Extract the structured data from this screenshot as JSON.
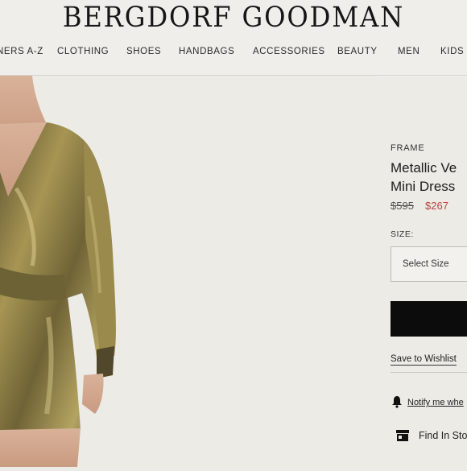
{
  "header": {
    "logo": "BERGDORF GOODMAN",
    "nav": [
      "NERS A-Z",
      "CLOTHING",
      "SHOES",
      "HANDBAGS",
      "ACCESSORIES",
      "BEAUTY",
      "MEN",
      "KIDS"
    ]
  },
  "product": {
    "brand": "FRAME",
    "title_line1": "Metallic Ve",
    "title_line2": "Mini Dress",
    "price_original": "$595",
    "price_sale": "$267",
    "size_label": "SIZE:",
    "size_placeholder": "Select Size",
    "save_wishlist": "Save to Wishlist",
    "notify": "Notify me whe",
    "find_in_store": "Find In Sto"
  },
  "colors": {
    "background": "#ecebe6",
    "sale_price": "#b5463f",
    "button": "#0c0c0c",
    "dress_gold": "#8a7a45"
  },
  "icons": {
    "bell": "bell-icon",
    "store": "store-icon"
  }
}
